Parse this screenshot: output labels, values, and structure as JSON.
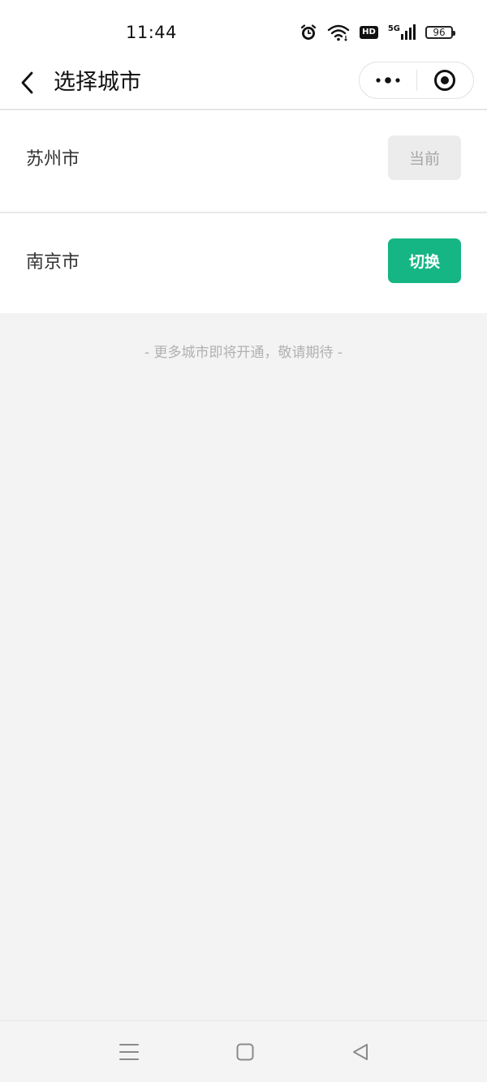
{
  "status_bar": {
    "time": "11:44",
    "network": "5G",
    "hd_label": "HD",
    "battery_level": "96",
    "icons": [
      "alarm-icon",
      "wifi-icon",
      "hd-icon",
      "signal-5g-icon",
      "battery-icon"
    ]
  },
  "nav": {
    "title": "选择城市",
    "back_icon": "back-chevron-icon",
    "more_icon": "more-dots-icon",
    "close_icon": "target-circle-icon"
  },
  "cities": [
    {
      "name": "苏州市",
      "action_label": "当前",
      "action_state": "current"
    },
    {
      "name": "南京市",
      "action_label": "切换",
      "action_state": "switch"
    }
  ],
  "footer_note": "- 更多城市即将开通，敬请期待 -",
  "colors": {
    "accent": "#15b683",
    "current_bg": "#ececec",
    "current_text": "#a6a6a6",
    "page_bg": "#f3f3f3"
  },
  "system_nav": {
    "icons": [
      "menu-lines-icon",
      "home-square-icon",
      "back-triangle-icon"
    ]
  }
}
